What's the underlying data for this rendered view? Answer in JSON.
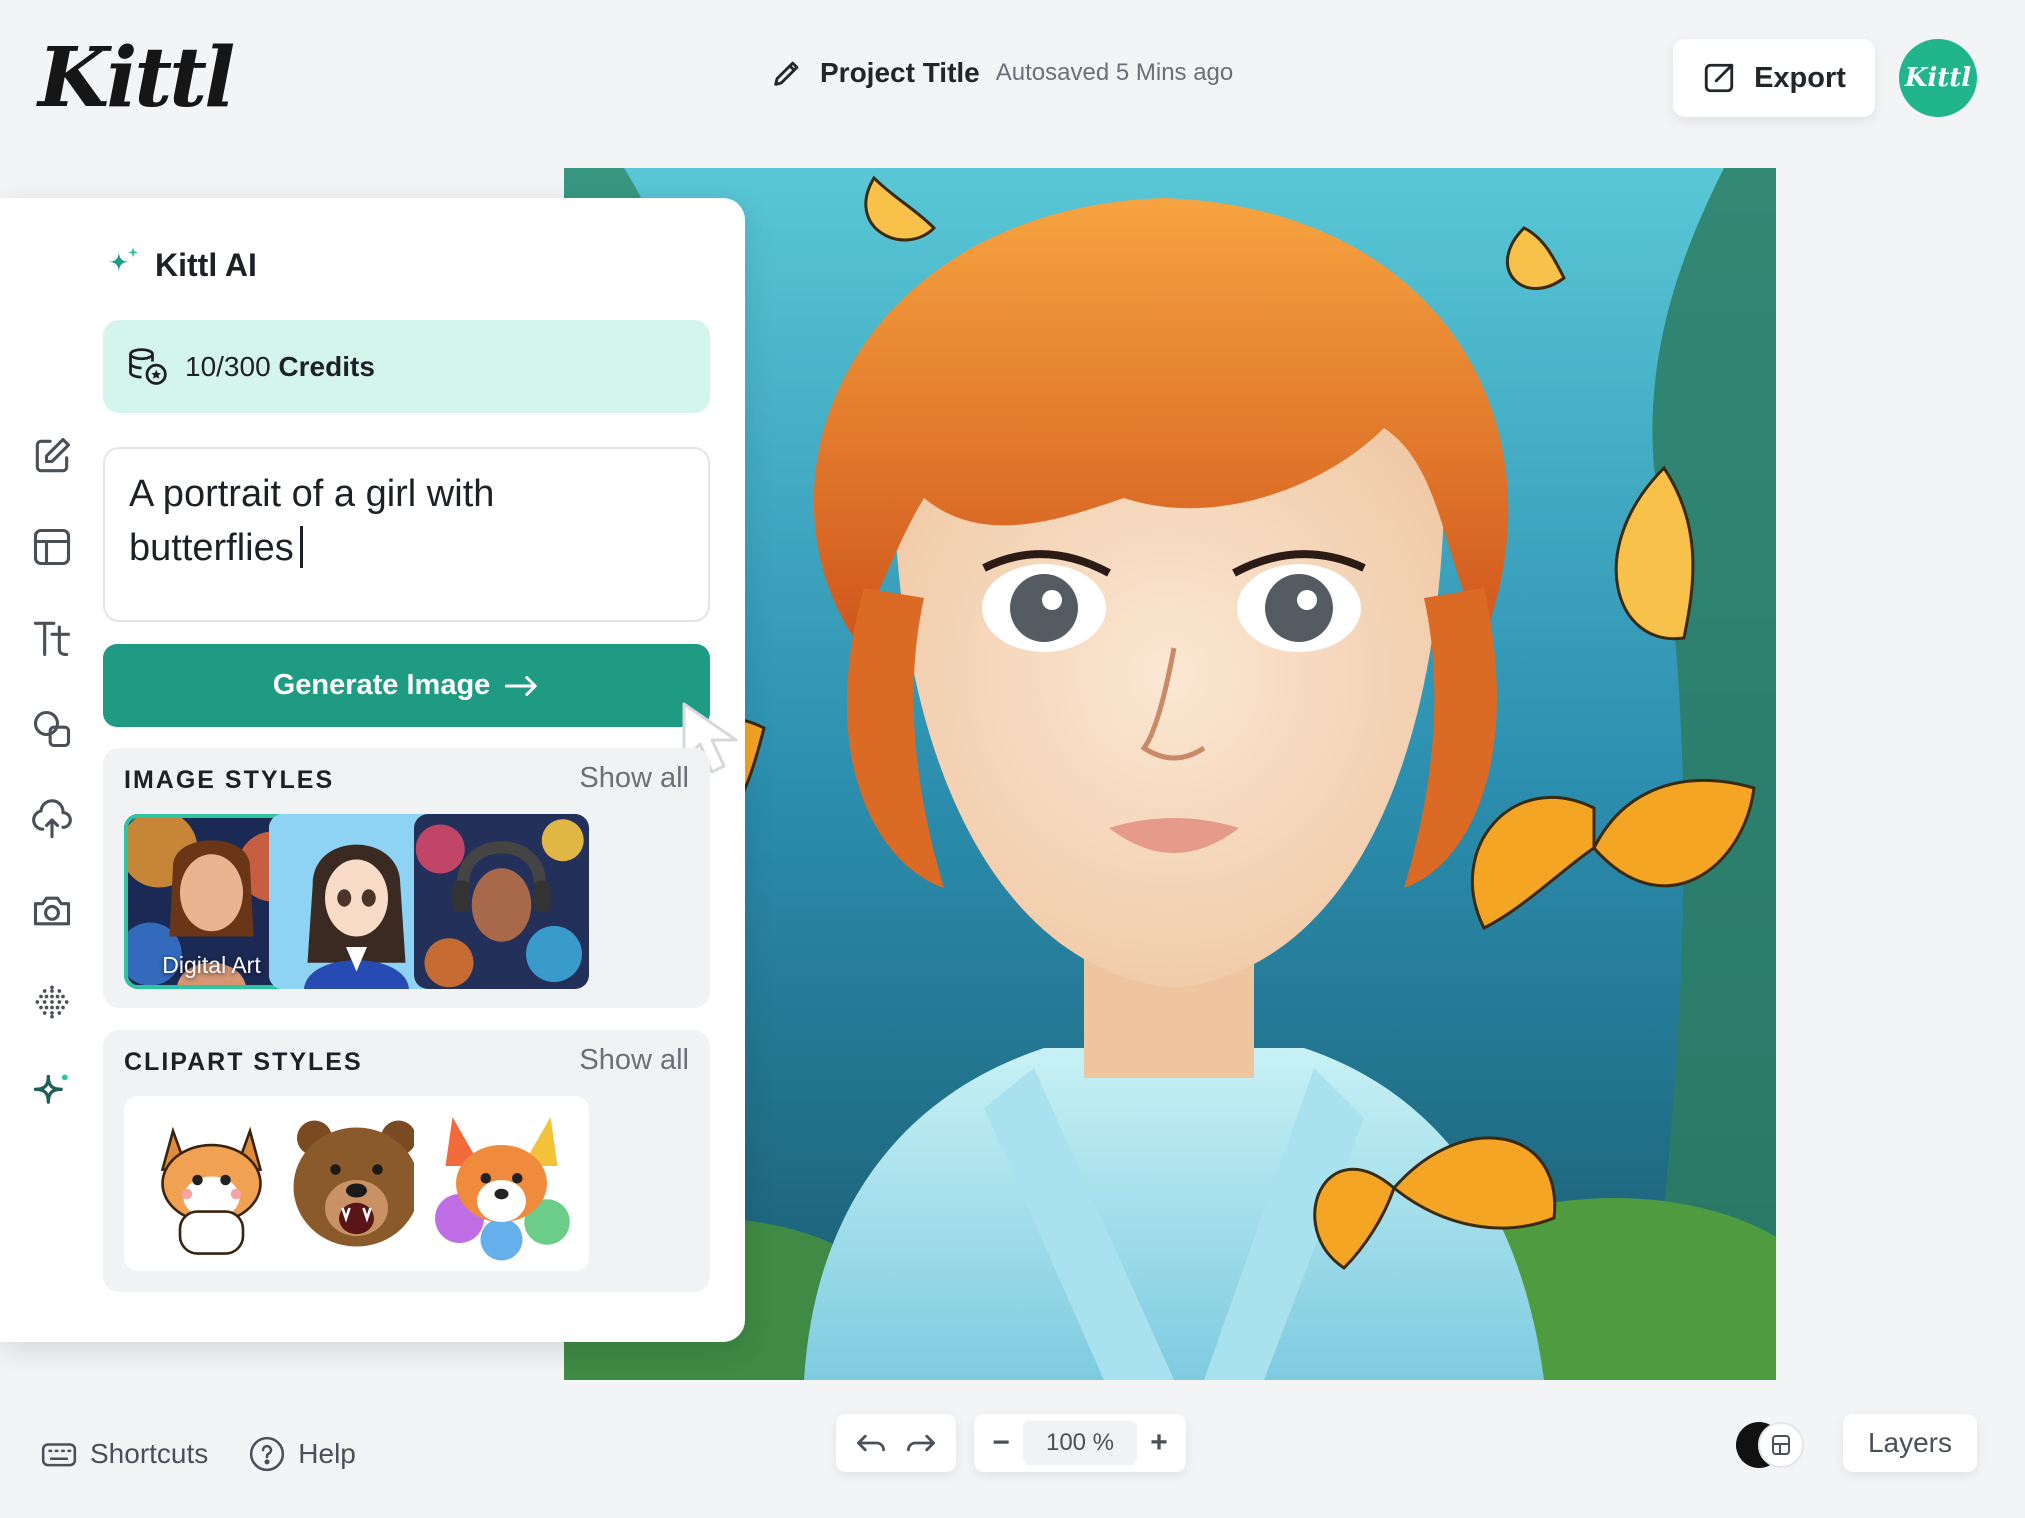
{
  "app": {
    "logo": "Kittl",
    "avatar_text": "Kittl"
  },
  "header": {
    "project_title": "Project Title",
    "autosave_status": "Autosaved 5 Mins ago",
    "export_label": "Export"
  },
  "ai_panel": {
    "title": "Kittl AI",
    "credits_used": "10/300",
    "credits_label": "Credits",
    "prompt_line1": "A portrait of a girl with",
    "prompt_line2": "butterflies",
    "generate_label": "Generate Image",
    "image_styles": {
      "title": "IMAGE STYLES",
      "show_all": "Show all",
      "items": [
        {
          "label": "Digital Art",
          "selected": true
        },
        {
          "label": "",
          "selected": false
        },
        {
          "label": "",
          "selected": false
        }
      ]
    },
    "clipart_styles": {
      "title": "CLIPART STYLES",
      "show_all": "Show all"
    }
  },
  "toolbar": {
    "tools": [
      "edit-icon",
      "templates-icon",
      "text-icon",
      "shapes-icon",
      "upload-icon",
      "camera-icon",
      "pattern-icon",
      "ai-sparkle-icon"
    ],
    "active": "ai-sparkle-icon"
  },
  "footer": {
    "shortcuts_label": "Shortcuts",
    "help_label": "Help",
    "zoom_value": "100 %",
    "zoom_out": "−",
    "zoom_in": "+",
    "layers_label": "Layers"
  },
  "colors": {
    "accent": "#1f9a83",
    "credits_bg": "#d4f5ec",
    "avatar": "#21b58c",
    "selected_outline": "#2fc4a0"
  }
}
